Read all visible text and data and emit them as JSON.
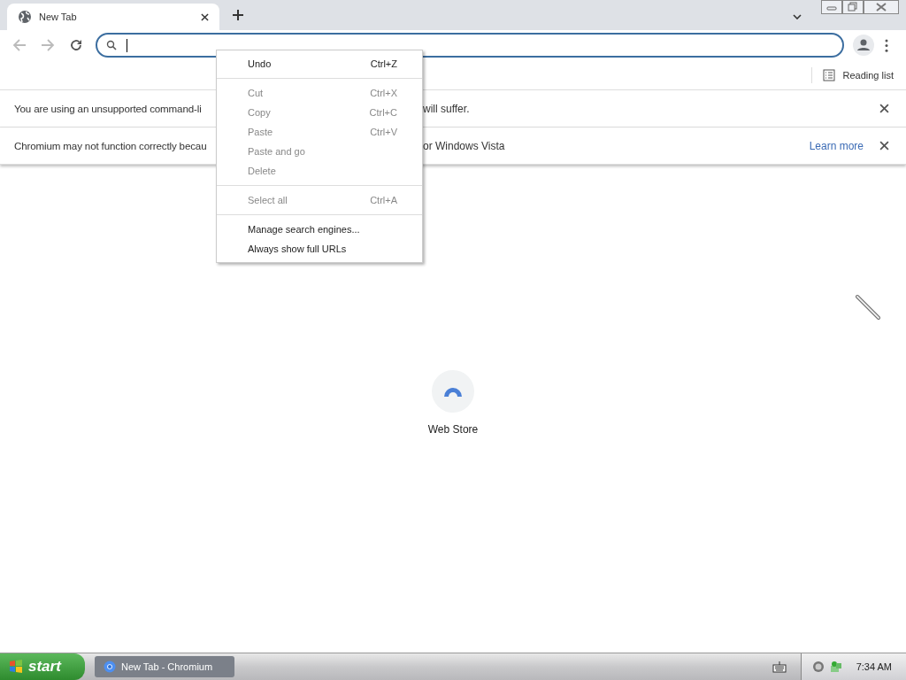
{
  "tab": {
    "title": "New Tab",
    "selected": true
  },
  "bookmarks_bar": {
    "reading_list": "Reading list"
  },
  "infobars": [
    {
      "visible_start": "You are using an unsupported command-li",
      "visible_end": "will suffer."
    },
    {
      "visible_start": "Chromium may not function correctly becau",
      "visible_end": "or Windows Vista",
      "link": "Learn more"
    }
  ],
  "context_menu": [
    {
      "kind": "item",
      "label": "Undo",
      "shortcut": "Ctrl+Z",
      "disabled": false
    },
    {
      "kind": "separator"
    },
    {
      "kind": "item",
      "label": "Cut",
      "shortcut": "Ctrl+X",
      "disabled": true
    },
    {
      "kind": "item",
      "label": "Copy",
      "shortcut": "Ctrl+C",
      "disabled": true
    },
    {
      "kind": "item",
      "label": "Paste",
      "shortcut": "Ctrl+V",
      "disabled": true
    },
    {
      "kind": "item",
      "label": "Paste and go",
      "disabled": true
    },
    {
      "kind": "item",
      "label": "Delete",
      "disabled": true
    },
    {
      "kind": "separator"
    },
    {
      "kind": "item",
      "label": "Select all",
      "shortcut": "Ctrl+A",
      "disabled": true
    },
    {
      "kind": "separator"
    },
    {
      "kind": "item",
      "label": "Manage search engines...",
      "disabled": false
    },
    {
      "kind": "item",
      "label": "Always show full URLs",
      "disabled": false
    }
  ],
  "shortcut_tile": {
    "label": "Web Store"
  },
  "taskbar": {
    "start": "start",
    "tasks": [
      {
        "label": "New Tab - Chromium",
        "selected": true
      }
    ],
    "clock": "7:34 AM"
  }
}
